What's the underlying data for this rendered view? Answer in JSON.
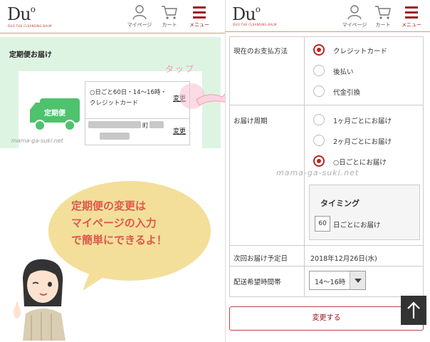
{
  "left": {
    "brand": "Du",
    "brand_sup": "o",
    "brand_sub": "DUO THE CLEANSING BALM",
    "nav": {
      "mypage": "マイページ",
      "cart": "カート",
      "menu": "メニュー"
    },
    "section_title": "定期便お届け",
    "truck_label": "定期便",
    "plan_text": "○日ごと60日・14～16時・クレジットカード",
    "change_label_1": "変更",
    "address_suffix": "町",
    "change_label_2": "変更",
    "watermark": "mama-ga-suki.net",
    "tap_label": "タップ",
    "bubble_lines": [
      "定期便の変更は",
      "マイページの入力",
      "で簡単にできるよ！"
    ]
  },
  "right": {
    "nav": {
      "mypage": "マイページ",
      "cart": "カート",
      "menu": "メニュー"
    },
    "payment_label": "現在のお支払方法",
    "payment_options": [
      {
        "label": "クレジットカード",
        "selected": true
      },
      {
        "label": "後払い",
        "selected": false
      },
      {
        "label": "代金引換",
        "selected": false
      }
    ],
    "cycle_label": "お届け周期",
    "cycle_options": [
      {
        "label": "1ヶ月ごとにお届け",
        "selected": false
      },
      {
        "label": "2ヶ月ごとにお届け",
        "selected": false
      },
      {
        "label": "○日ごとにお届け",
        "selected": true
      }
    ],
    "timing_title": "タイミング",
    "timing_value": "60",
    "timing_suffix": "日ごとにお届け",
    "next_date_label": "次回お届け予定日",
    "next_date_value": "2018年12月26日(水)",
    "time_label": "配送希望時間帯",
    "time_value": "14～16時",
    "submit_label": "変更する",
    "watermark": "mama-ga-suki.net"
  },
  "colors": {
    "accent": "#a01622",
    "green_bg": "#def4e2",
    "truck": "#4fc26d",
    "bubble": "#f3df9a",
    "bubble_text": "#e0574b",
    "tap": "#f19fb4"
  }
}
